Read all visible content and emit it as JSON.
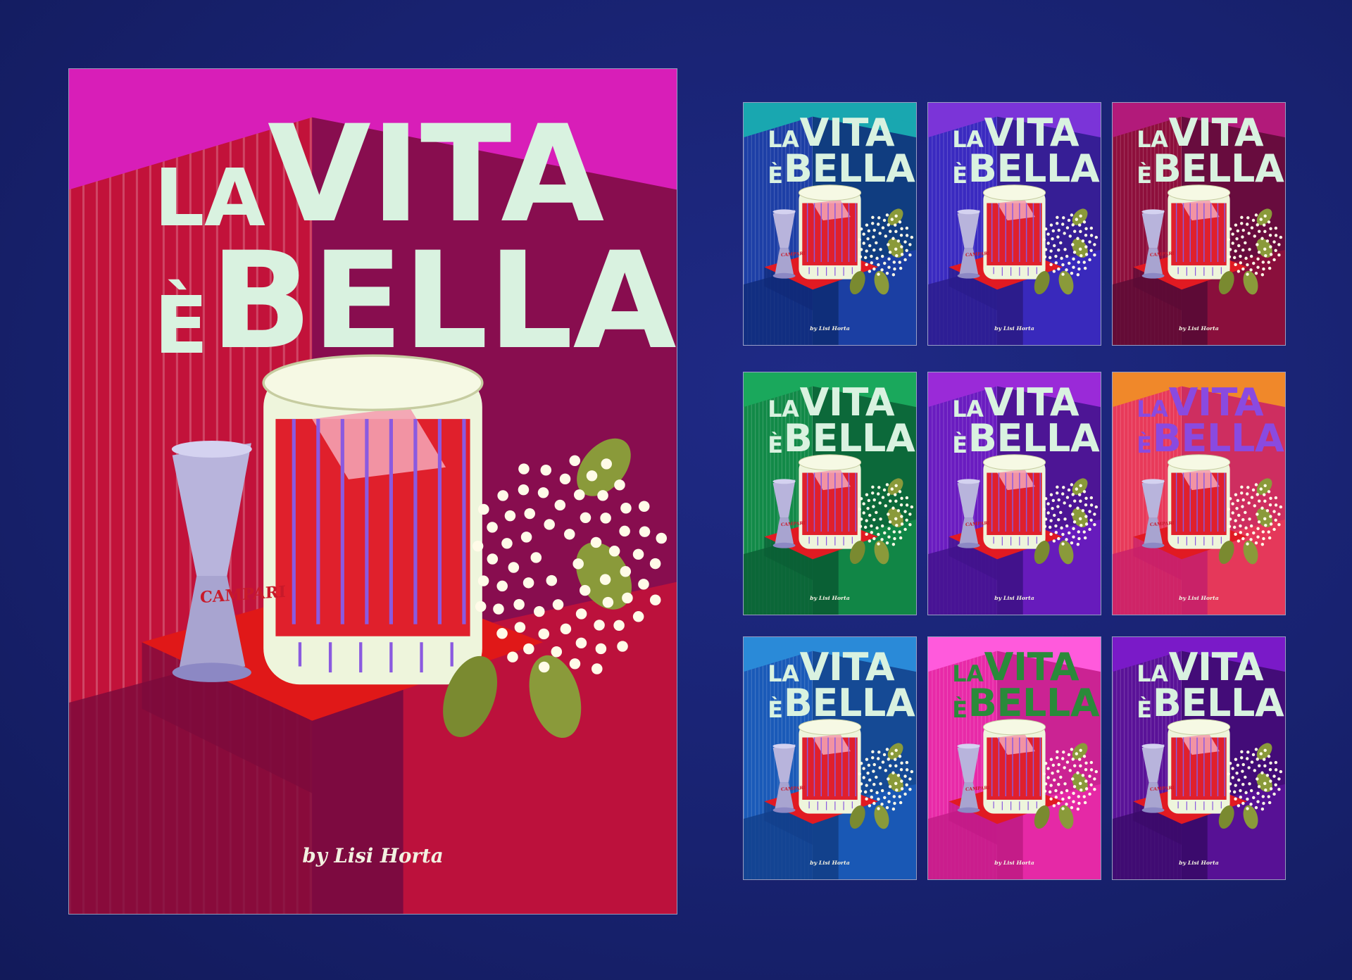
{
  "poster": {
    "title_small_1": "LA",
    "title_big_1": "VITA",
    "title_small_2": "È",
    "title_big_2": "BELLA",
    "credit": "by Lisi Horta",
    "brand": "CAMPARI"
  },
  "colorways": [
    {
      "name": "pink-red",
      "a": "#d81eb8",
      "b": "#c2123a",
      "c": "#7a0a3c",
      "d": "#e01818",
      "title": "#d9f2e0"
    },
    {
      "name": "teal-blue",
      "a": "#19a7b0",
      "b": "#1d3fa6",
      "c": "#0f2a78",
      "d": "#e11a22",
      "title": "#d9f2e0"
    },
    {
      "name": "violet-blue",
      "a": "#7b34d8",
      "b": "#3a2ac0",
      "c": "#2a1b8a",
      "d": "#e11a22",
      "title": "#d9f2e0"
    },
    {
      "name": "crimson",
      "a": "#b21a7a",
      "b": "#8e0f3c",
      "c": "#5a0a34",
      "d": "#e11a22",
      "title": "#d9f2e0"
    },
    {
      "name": "green",
      "a": "#1aa85c",
      "b": "#128a48",
      "c": "#0a5e34",
      "d": "#e11a22",
      "title": "#d9f2e0"
    },
    {
      "name": "purple-magenta",
      "a": "#9a2ad8",
      "b": "#6a1cc0",
      "c": "#40128a",
      "d": "#e11a22",
      "title": "#d9f2e0"
    },
    {
      "name": "orange-pink",
      "a": "#f0882a",
      "b": "#e83a5a",
      "c": "#c81f6a",
      "d": "#e11a22",
      "title": "#8a4ae0"
    },
    {
      "name": "blue",
      "a": "#2a8ad8",
      "b": "#1a5ab8",
      "c": "#123e8a",
      "d": "#e11a22",
      "title": "#d9f2e0"
    },
    {
      "name": "hot-pink",
      "a": "#ff5adc",
      "b": "#e82aa8",
      "c": "#c21a86",
      "d": "#e11a22",
      "title": "#2a8a3a"
    },
    {
      "name": "deep-purple",
      "a": "#7a1ac8",
      "b": "#5a1298",
      "c": "#3a0a6a",
      "d": "#e11a22",
      "title": "#d9f2e0"
    }
  ]
}
